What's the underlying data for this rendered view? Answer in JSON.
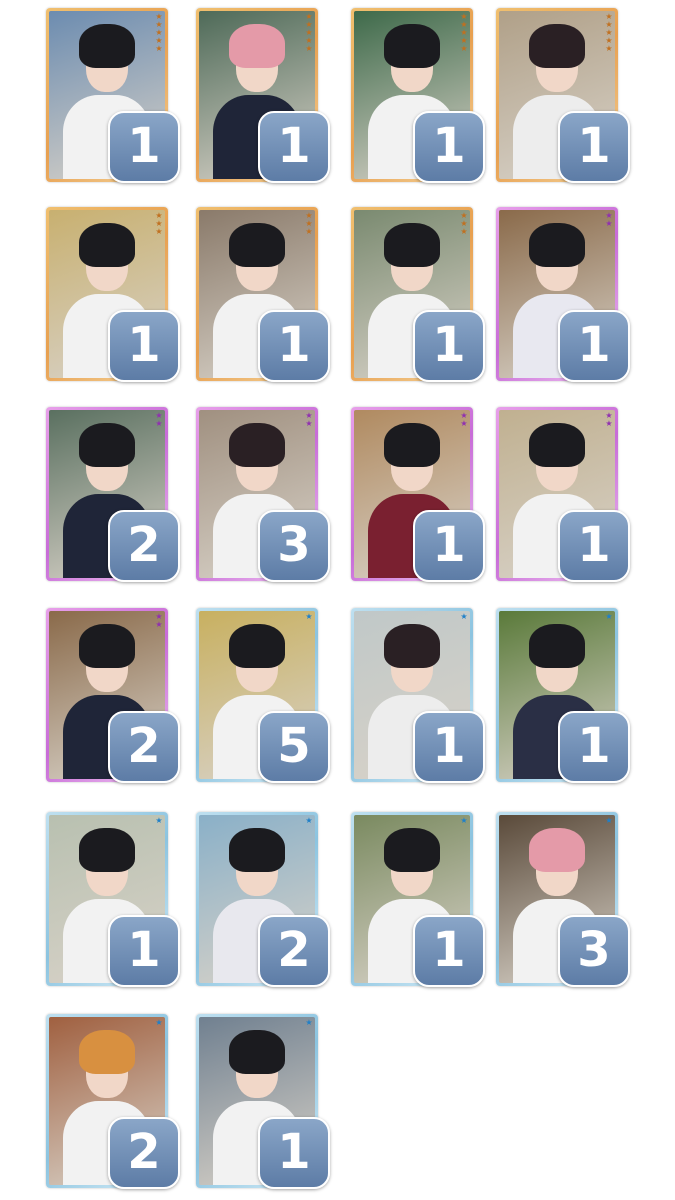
{
  "colors": {
    "gold_frame": "#e8a050",
    "purple_frame": "#c86cd8",
    "blue_frame": "#8cc4e0",
    "badge": "#6f8db5"
  },
  "cards": [
    {
      "count": "1",
      "frame": "gold",
      "stars": "★★★★★",
      "hair": "#1b1b1f",
      "bg": "#6c8cb0",
      "outfit": "#f2f2f2"
    },
    {
      "count": "1",
      "frame": "gold",
      "stars": "★★★★★",
      "hair": "#e49aa8",
      "bg": "#4e6a58",
      "outfit": "#1f2538"
    },
    {
      "count": "1",
      "frame": "gold",
      "stars": "★★★★★",
      "hair": "#1b1b1f",
      "bg": "#3e6a4a",
      "outfit": "#f2f2f2"
    },
    {
      "count": "1",
      "frame": "gold",
      "stars": "★★★★★",
      "hair": "#2a2024",
      "bg": "#b0a088",
      "outfit": "#ededed"
    },
    {
      "count": "1",
      "frame": "gold",
      "stars": "★★★",
      "hair": "#1b1b1f",
      "bg": "#c8b070",
      "outfit": "#f2f2f2"
    },
    {
      "count": "1",
      "frame": "gold",
      "stars": "★★★",
      "hair": "#1b1b1f",
      "bg": "#8a7a6a",
      "outfit": "#f2f2f2"
    },
    {
      "count": "1",
      "frame": "gold",
      "stars": "★★★",
      "hair": "#1b1b1f",
      "bg": "#7a8a70",
      "outfit": "#f2f2f2"
    },
    {
      "count": "1",
      "frame": "purple",
      "stars": "★★",
      "hair": "#1b1b1f",
      "bg": "#8a6a4a",
      "outfit": "#e8e8f0"
    },
    {
      "count": "2",
      "frame": "purple",
      "stars": "★★",
      "hair": "#1b1b1f",
      "bg": "#5a7060",
      "outfit": "#1f2538"
    },
    {
      "count": "3",
      "frame": "purple",
      "stars": "★★",
      "hair": "#2a2024",
      "bg": "#a09080",
      "outfit": "#f2f2f2"
    },
    {
      "count": "1",
      "frame": "purple",
      "stars": "★★",
      "hair": "#1b1b1f",
      "bg": "#b08a60",
      "outfit": "#7a2030"
    },
    {
      "count": "1",
      "frame": "purple",
      "stars": "★★",
      "hair": "#1b1b1f",
      "bg": "#c0b090",
      "outfit": "#f2f2f2"
    },
    {
      "count": "2",
      "frame": "purple",
      "stars": "★★",
      "hair": "#1b1b1f",
      "bg": "#8a6a4a",
      "outfit": "#1f2538"
    },
    {
      "count": "5",
      "frame": "blue",
      "stars": "★",
      "hair": "#1b1b1f",
      "bg": "#c8b060",
      "outfit": "#f2f2f2"
    },
    {
      "count": "1",
      "frame": "blue",
      "stars": "★",
      "hair": "#2a2024",
      "bg": "#c0c8c8",
      "outfit": "#ededed"
    },
    {
      "count": "1",
      "frame": "blue",
      "stars": "★",
      "hair": "#1b1b1f",
      "bg": "#5a7a3a",
      "outfit": "#2a2f45"
    },
    {
      "count": "1",
      "frame": "blue",
      "stars": "★",
      "hair": "#1b1b1f",
      "bg": "#b8c0b0",
      "outfit": "#f2f2f2"
    },
    {
      "count": "2",
      "frame": "blue",
      "stars": "★",
      "hair": "#1b1b1f",
      "bg": "#8ab0c8",
      "outfit": "#e8e8ee"
    },
    {
      "count": "1",
      "frame": "blue",
      "stars": "★",
      "hair": "#1b1b1f",
      "bg": "#7a8a60",
      "outfit": "#f2f2f2"
    },
    {
      "count": "3",
      "frame": "blue",
      "stars": "★",
      "hair": "#e49aa8",
      "bg": "#5a4a3a",
      "outfit": "#f2f2f2"
    },
    {
      "count": "2",
      "frame": "blue",
      "stars": "★",
      "hair": "#d89040",
      "bg": "#a06040",
      "outfit": "#f2f2f2"
    },
    {
      "count": "1",
      "frame": "blue",
      "stars": "★",
      "hair": "#1b1b1f",
      "bg": "#708090",
      "outfit": "#f2f2f2"
    }
  ]
}
